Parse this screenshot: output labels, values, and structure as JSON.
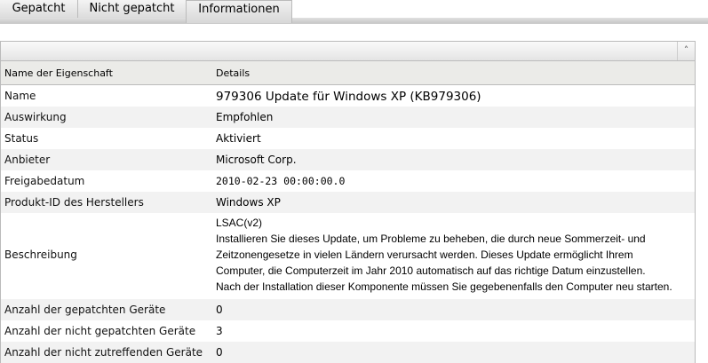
{
  "tabs": [
    "Gepatcht",
    "Nicht gepatcht",
    "Informationen"
  ],
  "table": {
    "headers": [
      "Name der Eigenschaft",
      "Details"
    ],
    "rows": [
      {
        "name": "Name",
        "value": "979306 Update für Windows XP (KB979306)"
      },
      {
        "name": "Auswirkung",
        "value": "Empfohlen"
      },
      {
        "name": "Status",
        "value": "Aktiviert"
      },
      {
        "name": "Anbieter",
        "value": "Microsoft Corp."
      },
      {
        "name": "Freigabedatum",
        "value": "2010-02-23 00:00:00.0"
      },
      {
        "name": "Produkt-ID des Herstellers",
        "value": "Windows XP"
      },
      {
        "name": "Beschreibung",
        "value": "LSAC(v2)",
        "lines": [
          "Installieren Sie dieses Update, um Probleme zu beheben, die durch neue Sommerzeit- und",
          "Zeitzonengesetze in vielen Ländern verursacht werden. Dieses Update ermöglicht Ihrem",
          "Computer, die Computerzeit im Jahr 2010 automatisch auf das richtige Datum einzustellen.",
          "Nach der Installation dieser Komponente müssen Sie gegebenenfalls den Computer neu starten."
        ]
      },
      {
        "name": "Anzahl der gepatchten Geräte",
        "value": "0"
      },
      {
        "name": "Anzahl der nicht gepatchten Geräte",
        "value": "3"
      },
      {
        "name": "Anzahl der nicht zutreffenden Geräte",
        "value": "0"
      }
    ]
  }
}
